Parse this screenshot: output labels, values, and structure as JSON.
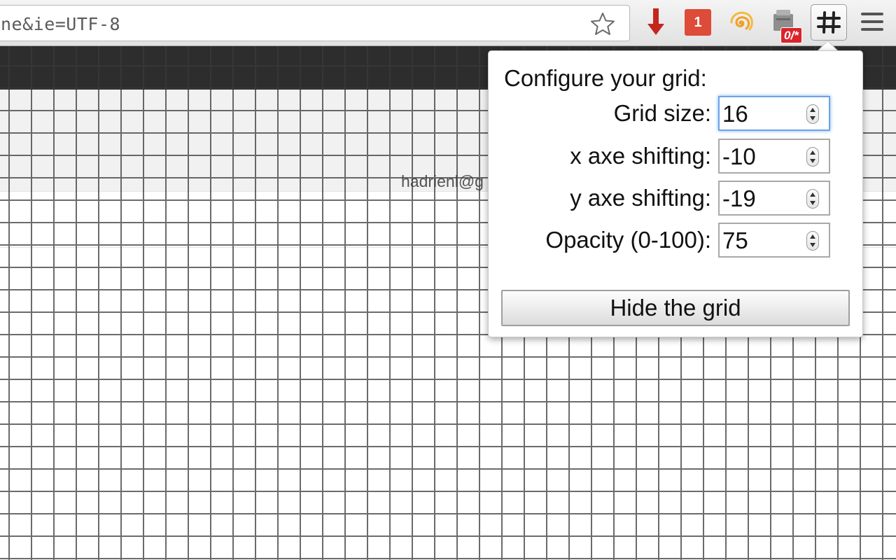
{
  "browser": {
    "url_fragment": "ne&ie=UTF-8",
    "extensions": {
      "download_icon": "down-arrow-icon",
      "badge_number": "1",
      "swirl_icon": "spiral-icon",
      "counter_badge": "0/*",
      "grid_icon": "grid-hash-icon",
      "menu_icon": "hamburger-menu-icon"
    }
  },
  "page": {
    "account_text": "hadrienl@g"
  },
  "popup": {
    "title": "Configure your grid:",
    "fields": [
      {
        "label": "Grid size:",
        "value": "16"
      },
      {
        "label": "x axe shifting:",
        "value": "-10"
      },
      {
        "label": "y axe shifting:",
        "value": "-19"
      },
      {
        "label": "Opacity (0-100):",
        "value": "75"
      }
    ],
    "hide_button": "Hide the grid"
  },
  "colors": {
    "badge_red": "#dd4b39",
    "focus_blue": "#6da3e8",
    "dark_bar": "#2d2d2d"
  }
}
